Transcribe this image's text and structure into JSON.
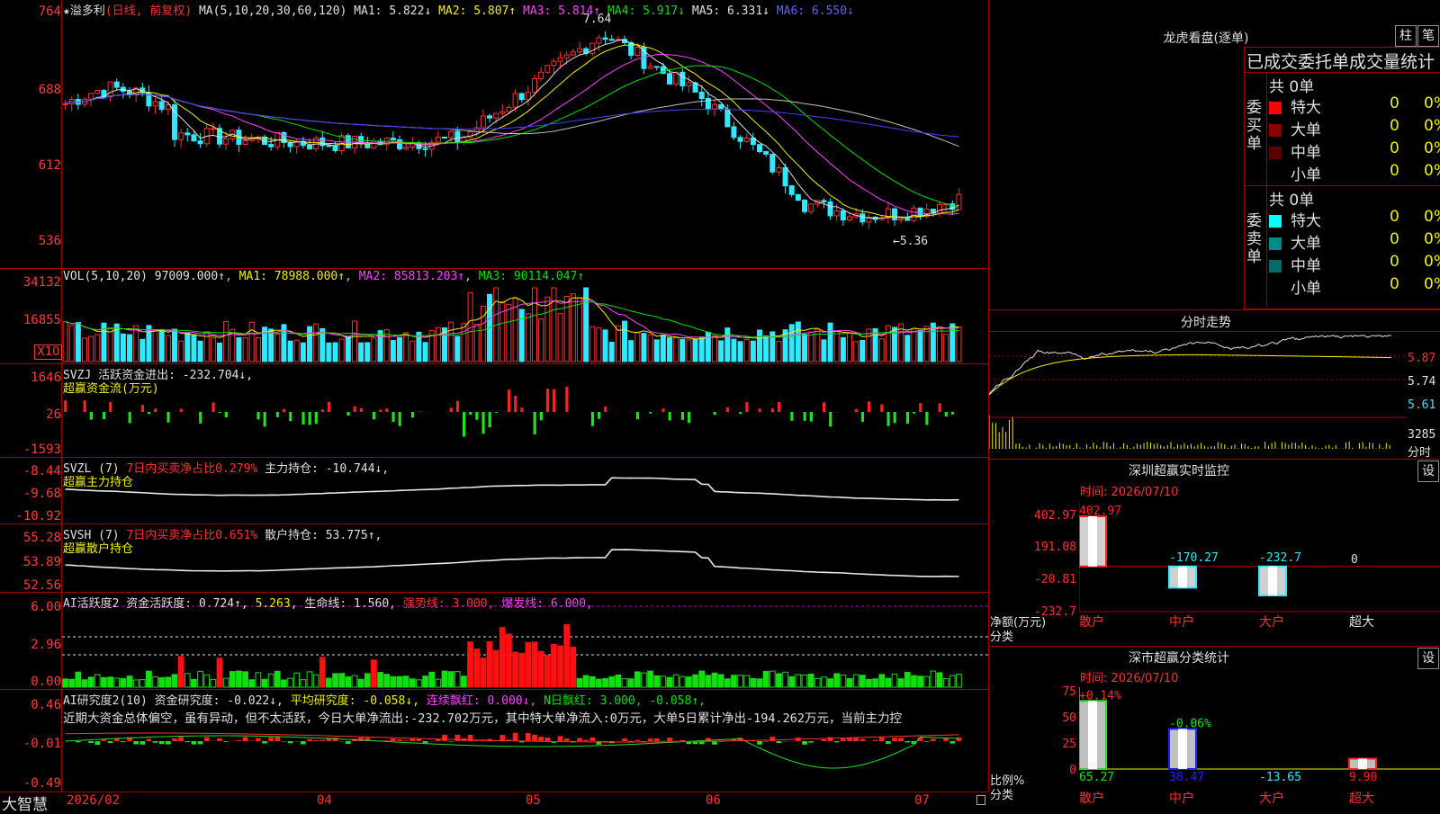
{
  "stock": {
    "name": "溢多利",
    "period": "(日线, 前复权)"
  },
  "ma_line": {
    "label": "MA(5,10,20,30,60,120)",
    "ma1": "MA1: 5.822↓",
    "ma2": "MA2: 5.807↑",
    "ma3": "MA3: 5.814↑",
    "ma4": "MA4: 5.917↓",
    "ma5": "MA5: 6.331↓",
    "ma6": "MA6: 6.550↓"
  },
  "price_axis": [
    "764",
    "688",
    "612",
    "536"
  ],
  "price_high": "7.64",
  "price_low": "←5.36",
  "vol": {
    "label": "VOL(5,10,20) 97009.000↑",
    "ma1": "MA1: 78988.000↑",
    "ma2": "MA2: 85813.203↑",
    "ma3": "MA3: 90114.047↑",
    "axis": [
      "34132",
      "16855"
    ],
    "unit": "X10"
  },
  "svzj": {
    "line1": "SVZJ  活跃资金进出: -232.704↓,",
    "line2": "超赢资金流(万元)",
    "axis": [
      "1646",
      "26",
      "-1593"
    ]
  },
  "svzl": {
    "pre": "SVZL (7) ",
    "red": "7日内买卖净占比0.279%",
    "post": " 主力持仓: -10.744↓,",
    "line2": "超赢主力持仓",
    "axis": [
      "-8.44",
      "-9.68",
      "-10.92"
    ]
  },
  "svsh": {
    "pre": "SVSH (7) ",
    "red": "7日内买卖净占比0.651%",
    "post": " 散户持仓: 53.775↑,",
    "line2": "超赢散户持仓",
    "axis": [
      "55.28",
      "53.89",
      "52.56"
    ]
  },
  "ai2": {
    "p1": "AI活跃度2 资金活跃度: 0.724↑, ",
    "p2": "5.263",
    "p3": ", 生命线: 1.560, ",
    "p4": "强势线: 3.000, ",
    "p5": "爆发线: 6.000,",
    "axis": [
      "6.00",
      "2.96",
      "0.00"
    ]
  },
  "ai_res": {
    "p1": "AI研究度2(10) 资金研究度: -0.022↓, ",
    "p2": "平均研究度: -0.058↓, ",
    "p3": "连续飘红: 0.000↓, ",
    "p4": "N日飘红: 3.000, -0.058↑,",
    "desc": "近期大资金总体偏空，虽有异动，但不太活跃，今日大单净流出:-232.702万元，其中特大单净流入:0万元，大单5日累计净出-194.262万元，当前主力控",
    "axis": [
      "0.46",
      "-0.01",
      "-0.49"
    ]
  },
  "dates": [
    "2026/02",
    "04",
    "05",
    "06",
    "07"
  ],
  "brand": "大智慧",
  "lhb": {
    "title": "龙虎看盘(逐单)",
    "btn1": "柱",
    "btn2": "笔",
    "header": "已成交委托单成交量统计",
    "buy_label": "委买单",
    "sell_label": "委卖单",
    "buy_total": "共 0单",
    "sell_total": "共 0单",
    "buy_rows": [
      {
        "name": "特大",
        "v": "0",
        "p": "0%",
        "color": "#ff0000"
      },
      {
        "name": "大单",
        "v": "0",
        "p": "0%",
        "color": "#8b0000"
      },
      {
        "name": "中单",
        "v": "0",
        "p": "0%",
        "color": "#5a0000"
      },
      {
        "name": "小单",
        "v": "0",
        "p": "0%",
        "color": "#000000"
      }
    ],
    "sell_rows": [
      {
        "name": "特大",
        "v": "0",
        "p": "0%",
        "color": "#00ffff"
      },
      {
        "name": "大单",
        "v": "0",
        "p": "0%",
        "color": "#008b8b"
      },
      {
        "name": "中单",
        "v": "0",
        "p": "0%",
        "color": "#006a6a"
      },
      {
        "name": "小单",
        "v": "0",
        "p": "0%",
        "color": "#000000"
      }
    ]
  },
  "fenshi": {
    "title": "分时走势",
    "axis": [
      "5.87",
      "5.74",
      "5.61",
      "3285"
    ],
    "unit": "分时"
  },
  "sz_monitor": {
    "title": "深圳超赢实时监控",
    "btn": "设",
    "time": "时间: 2026/07/10",
    "axis": [
      "402.97",
      "191.08",
      "-20.81",
      "-232.7"
    ],
    "ylabel": "净额(万元)",
    "xlabel": "分类",
    "bars": [
      {
        "cat": "散户",
        "val": "402.97"
      },
      {
        "cat": "中户",
        "val": "-170.27"
      },
      {
        "cat": "大户",
        "val": "-232.7"
      },
      {
        "cat": "超大",
        "val": "0"
      }
    ]
  },
  "sz_class": {
    "title": "深市超赢分类统计",
    "btn": "设",
    "time": "时间: 2026/07/10",
    "axis": [
      "75",
      "50",
      "25",
      "0"
    ],
    "ylabel": "比例%",
    "xlabel": "分类",
    "bars": [
      {
        "cat": "散户",
        "val": "65.27",
        "top": "+0.14%"
      },
      {
        "cat": "中户",
        "val": "38.47",
        "top": "-0.06%"
      },
      {
        "cat": "大户",
        "val": "-13.65",
        "top": ""
      },
      {
        "cat": "超大",
        "val": "9.90",
        "top": ""
      }
    ]
  },
  "chart_data": [
    {
      "type": "bar",
      "title": "深圳超赢实时监控",
      "xlabel": "分类",
      "ylabel": "净额(万元)",
      "categories": [
        "散户",
        "中户",
        "大户",
        "超大"
      ],
      "values": [
        402.97,
        -170.27,
        -232.7,
        0
      ],
      "ylim": [
        -232.7,
        402.97
      ]
    },
    {
      "type": "bar",
      "title": "深市超赢分类统计",
      "xlabel": "分类",
      "ylabel": "比例%",
      "categories": [
        "散户",
        "中户",
        "大户",
        "超大"
      ],
      "values": [
        65.27,
        38.47,
        -13.65,
        9.9
      ],
      "ylim": [
        0,
        75
      ]
    }
  ]
}
